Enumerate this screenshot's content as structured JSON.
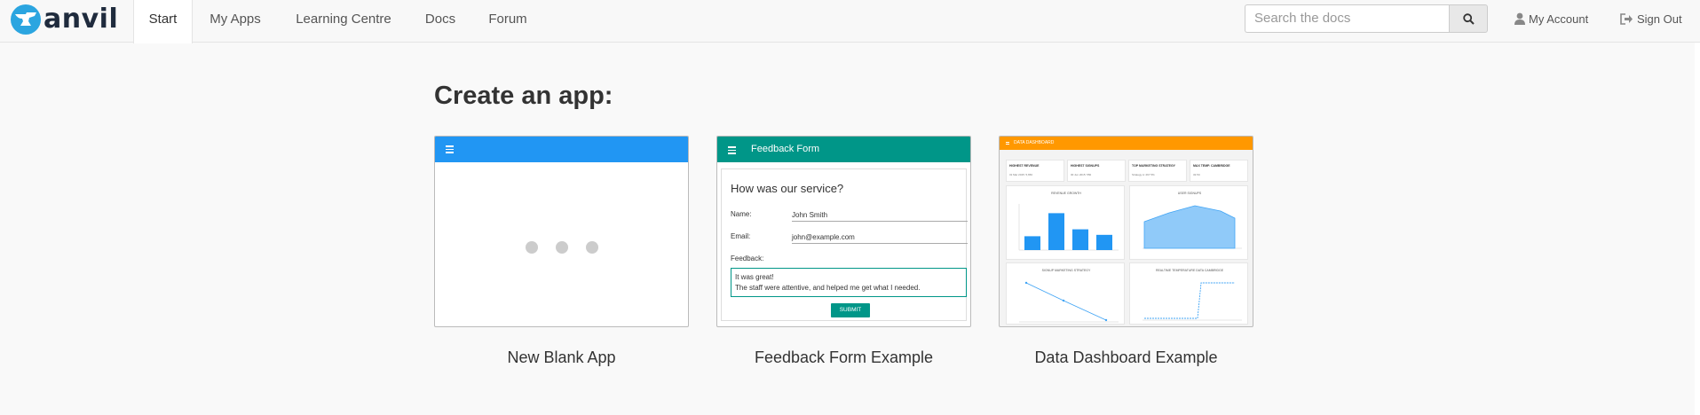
{
  "brand": {
    "name": "anvil",
    "color": "#2ba5e0"
  },
  "nav": {
    "tabs": [
      "Start",
      "My Apps",
      "Learning Centre",
      "Docs",
      "Forum"
    ],
    "active_tab": "Start",
    "search_placeholder": "Search the docs",
    "account_label": "My Account",
    "signout_label": "Sign Out"
  },
  "page": {
    "title": "Create an app:"
  },
  "templates": [
    {
      "label": "New Blank App",
      "header_color": "#2196f3"
    },
    {
      "label": "Feedback Form Example",
      "header_color": "#009688"
    },
    {
      "label": "Data Dashboard Example",
      "header_color": "#ff9800"
    }
  ],
  "feedback_preview": {
    "header_title": "Feedback Form",
    "question": "How was our service?",
    "name_label": "Name:",
    "name_value": "John Smith",
    "email_label": "Email:",
    "email_value": "john@example.com",
    "feedback_label": "Feedback:",
    "feedback_line1": "It was great!",
    "feedback_line2": "The staff were attentive, and helped me get what I needed.",
    "submit_label": "SUBMIT"
  },
  "dashboard_preview": {
    "header_title": "DATA DASHBOARD",
    "stats": [
      {
        "title": "HIGHEST REVENUE",
        "value": "31 Mar 2015: 5,650"
      },
      {
        "title": "HIGHEST SIGNUPS",
        "value": "30 Jun 2015: 550"
      },
      {
        "title": "TOP MARKETING STRATEGY",
        "value": "Strategy A: 267 5%"
      },
      {
        "title": "MAX TEMP. CAMBRIDGE",
        "value": "32.5C"
      }
    ],
    "panels": [
      "REVENUE GROWTH",
      "USER SIGNUPS",
      "SIGNUP MARKETING STRATEGY",
      "REALTIME TEMPERATURE DATA CAMBRIDGE"
    ],
    "revenue_bars": [
      0.3,
      0.8,
      0.45,
      0.33
    ]
  }
}
